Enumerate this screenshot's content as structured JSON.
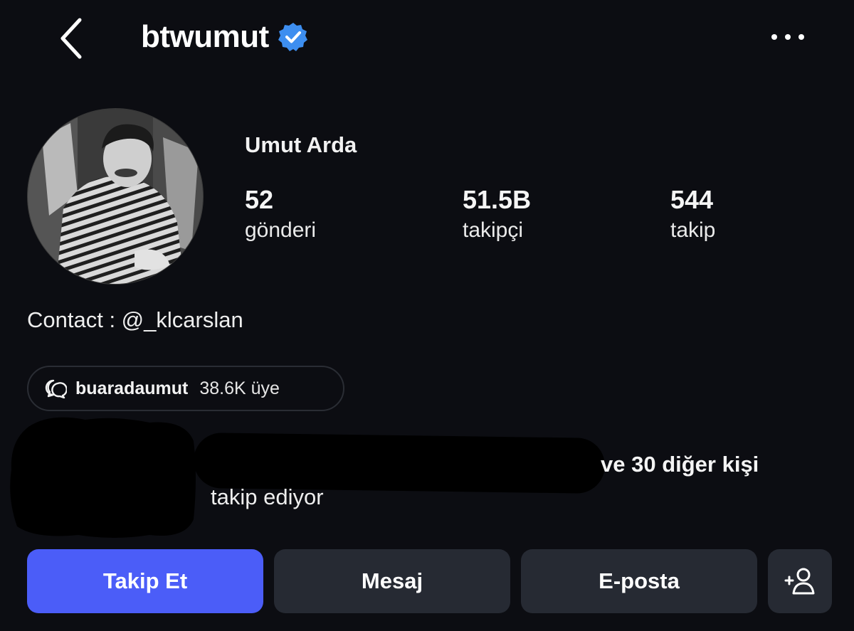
{
  "header": {
    "username": "btwumut",
    "verified": true,
    "icons": {
      "back": "chevron-left-icon",
      "verified": "verified-badge-icon",
      "more": "more-horizontal-icon"
    }
  },
  "profile": {
    "display_name": "Umut Arda",
    "stats": [
      {
        "value": "52",
        "label": "gönderi"
      },
      {
        "value": "51.5B",
        "label": "takipçi"
      },
      {
        "value": "544",
        "label": "takip"
      }
    ],
    "bio": "Contact : @_klcarslan"
  },
  "channel": {
    "icon": "broadcast-channel-icon",
    "name": "buaradaumut",
    "members": "38.6K üye"
  },
  "followed_by": {
    "line1": "ve 30 diğer kişi",
    "line2": "takip ediyor"
  },
  "actions": {
    "follow": "Takip Et",
    "message": "Mesaj",
    "email": "E-posta",
    "add_user_icon": "add-person-icon"
  },
  "colors": {
    "background": "#0c0d12",
    "accent": "#4b5df8",
    "verified": "#3d8ef0",
    "button_secondary": "#262a33"
  }
}
